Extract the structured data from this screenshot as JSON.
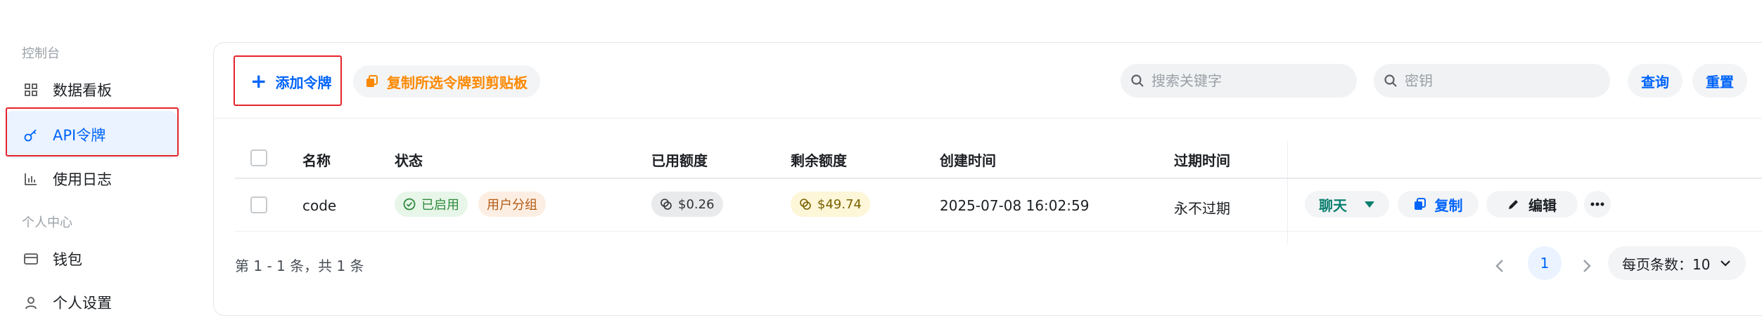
{
  "sidebar": {
    "section_console": "控制台",
    "section_personal": "个人中心",
    "items": [
      {
        "label": "数据看板",
        "icon": "grid-icon"
      },
      {
        "label": "API令牌",
        "icon": "key-icon",
        "active": true
      },
      {
        "label": "使用日志",
        "icon": "bar-chart-icon"
      },
      {
        "label": "钱包",
        "icon": "wallet-icon"
      },
      {
        "label": "个人设置",
        "icon": "user-icon"
      }
    ]
  },
  "toolbar": {
    "add_label": "添加令牌",
    "copy_label": "复制所选令牌到剪贴板",
    "search_keyword_placeholder": "搜索关键字",
    "search_key_placeholder": "密钥",
    "query_label": "查询",
    "reset_label": "重置"
  },
  "table": {
    "headers": {
      "name": "名称",
      "status": "状态",
      "used": "已用额度",
      "remaining": "剩余额度",
      "created": "创建时间",
      "expires": "过期时间"
    },
    "rows": [
      {
        "name": "code",
        "status": "已启用",
        "group": "用户分组",
        "used": "$0.26",
        "remaining": "$49.74",
        "created": "2025-07-08 16:02:59",
        "expires": "永不过期",
        "actions": {
          "chat": "聊天",
          "copy": "复制",
          "edit": "编辑"
        }
      }
    ]
  },
  "pagination": {
    "summary": "第 1 - 1 条，共 1 条",
    "current_page": "1",
    "page_size_label": "每页条数：10"
  },
  "colors": {
    "accent": "#0064fa",
    "warning": "#fc8800",
    "highlight_border": "#e5242b",
    "chat_green": "#0a7f6e"
  }
}
